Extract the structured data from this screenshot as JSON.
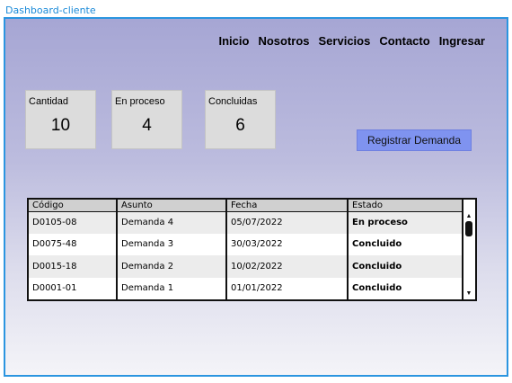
{
  "frame": {
    "title": "Dashboard-cliente"
  },
  "nav": {
    "items": [
      {
        "label": "Inicio"
      },
      {
        "label": "Nosotros"
      },
      {
        "label": "Servicios"
      },
      {
        "label": "Contacto"
      },
      {
        "label": "Ingresar"
      }
    ]
  },
  "stats": [
    {
      "label": "Cantidad",
      "value": "10"
    },
    {
      "label": "En proceso",
      "value": "4"
    },
    {
      "label": "Concluidas",
      "value": "6"
    }
  ],
  "actions": {
    "registrar_label": "Registrar Demanda"
  },
  "table": {
    "headers": [
      "Código",
      "Asunto",
      "Fecha",
      "Estado"
    ],
    "rows": [
      {
        "codigo": "D0105-08",
        "asunto": "Demanda 4",
        "fecha": "05/07/2022",
        "estado": "En proceso"
      },
      {
        "codigo": "D0075-48",
        "asunto": "Demanda 3",
        "fecha": "30/03/2022",
        "estado": "Concluido"
      },
      {
        "codigo": "D0015-18",
        "asunto": "Demanda 2",
        "fecha": "10/02/2022",
        "estado": "Concluido"
      },
      {
        "codigo": "D0001-01",
        "asunto": "Demanda 1",
        "fecha": "01/01/2022",
        "estado": "Concluido"
      }
    ]
  },
  "colors": {
    "frame_border": "#2b95e0",
    "button_bg": "#7f93f0",
    "card_bg": "#dcdcdc"
  },
  "icons": {
    "scroll_up": "▲",
    "scroll_down": "▼"
  }
}
